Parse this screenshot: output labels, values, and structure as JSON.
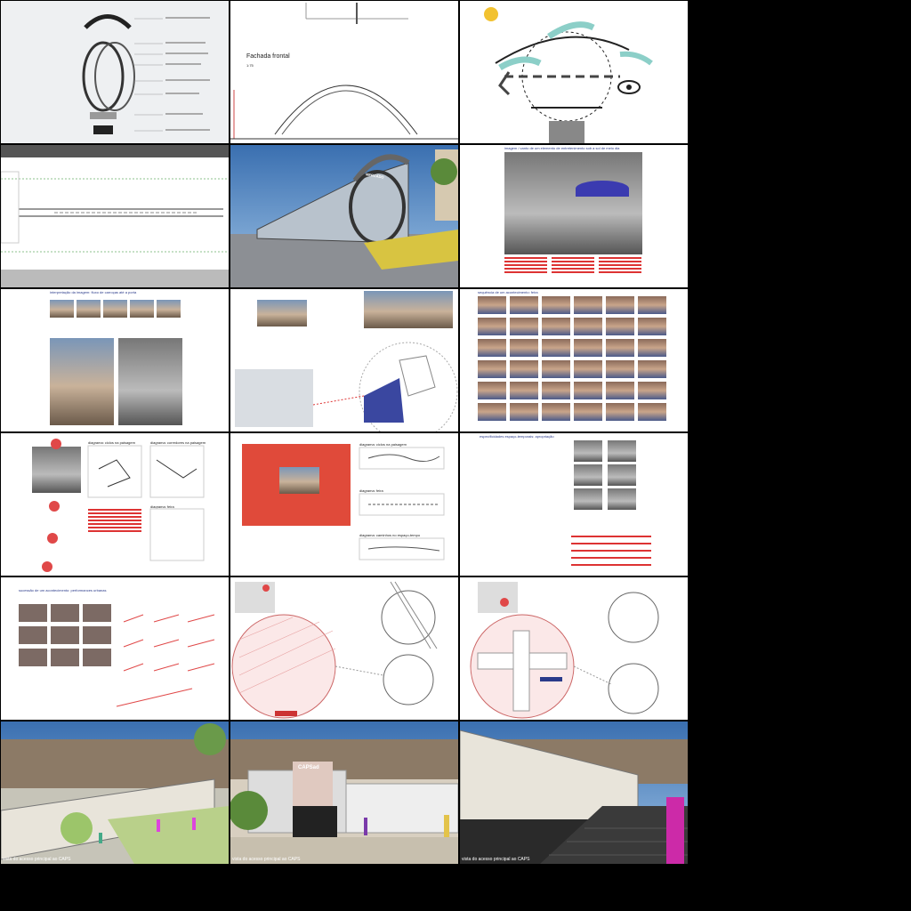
{
  "cells": [
    {
      "id": "exploded-structure",
      "caption": ""
    },
    {
      "id": "front-facade",
      "title": "Fachada frontal",
      "scale": "1:75"
    },
    {
      "id": "sun-diagram",
      "caption": ""
    },
    {
      "id": "site-plan",
      "caption": ""
    },
    {
      "id": "mercado-render",
      "sign": "MERCADO"
    },
    {
      "id": "street-photo",
      "heading": "imagem / canto de um elemento de entretenimento sob a sol de meio dia"
    },
    {
      "id": "image-sequence",
      "heading": "interpretação da imagem: fluxo de carroças até a porta"
    },
    {
      "id": "map-collage",
      "caption": ""
    },
    {
      "id": "photo-grid",
      "heading": "sequência de um acontecimento: feira"
    },
    {
      "id": "diagram-sketches",
      "labels": [
        "diagrama: ciclos na paisagem",
        "diagrama: corredores na paisagem",
        "diagrama: feira"
      ]
    },
    {
      "id": "red-panel",
      "labels": [
        "diagrama: ciclos na paisagem",
        "diagrama: feira",
        "diagrama: caminhos no espaço-tempo"
      ]
    },
    {
      "id": "performance-grid",
      "heading": "especificidades espaço-temporais: apropriação"
    },
    {
      "id": "urban-performances",
      "heading": "sucessão de um acontecimento: performances urbanas"
    },
    {
      "id": "circle-plan-1",
      "caption": ""
    },
    {
      "id": "circle-plan-2",
      "caption": ""
    },
    {
      "id": "caps-render-1",
      "caption": "vista do acesso principal ao CAPS"
    },
    {
      "id": "caps-render-2",
      "caption": "vista do acesso principal ao CAPS",
      "sign": "CAPSad"
    },
    {
      "id": "caps-render-3",
      "caption": "vista do acesso principal ao CAPS"
    }
  ]
}
